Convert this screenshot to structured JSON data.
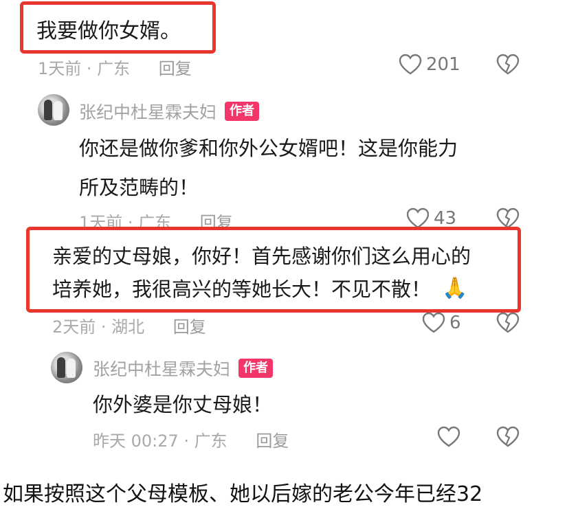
{
  "comments": [
    {
      "text": "我要做你女婿。",
      "time": "1天前 · 广东",
      "reply": "回复",
      "likes": "201"
    },
    {
      "user": "张纪中杜星霖夫妇",
      "badge": "作者",
      "text_line1": "你还是做你爹和你外公女婿吧！这是你能力",
      "text_line2": "所及范畴的！",
      "time": "1天前 · 广东",
      "reply": "回复",
      "likes": "43"
    },
    {
      "text_line1": "亲爱的丈母娘，你好！首先感谢你们这么用心的",
      "text_line2": "培养她，我很高兴的等她长大！不见不散！",
      "emoji": "🙏",
      "time": "2天前 · 湖北",
      "reply": "回复",
      "likes": "6"
    },
    {
      "user": "张纪中杜星霖夫妇",
      "badge": "作者",
      "text": "你外婆是你丈母娘！",
      "time": "昨天 00:27 · 广东",
      "reply": "回复"
    }
  ],
  "footer_text": "如果按照这个父母模板、她以后嫁的老公今年已经32",
  "colors": {
    "highlight_border": "#e8362c",
    "author_badge": "#f2366a"
  },
  "icons": [
    "heart-outline-icon",
    "broken-heart-icon"
  ]
}
